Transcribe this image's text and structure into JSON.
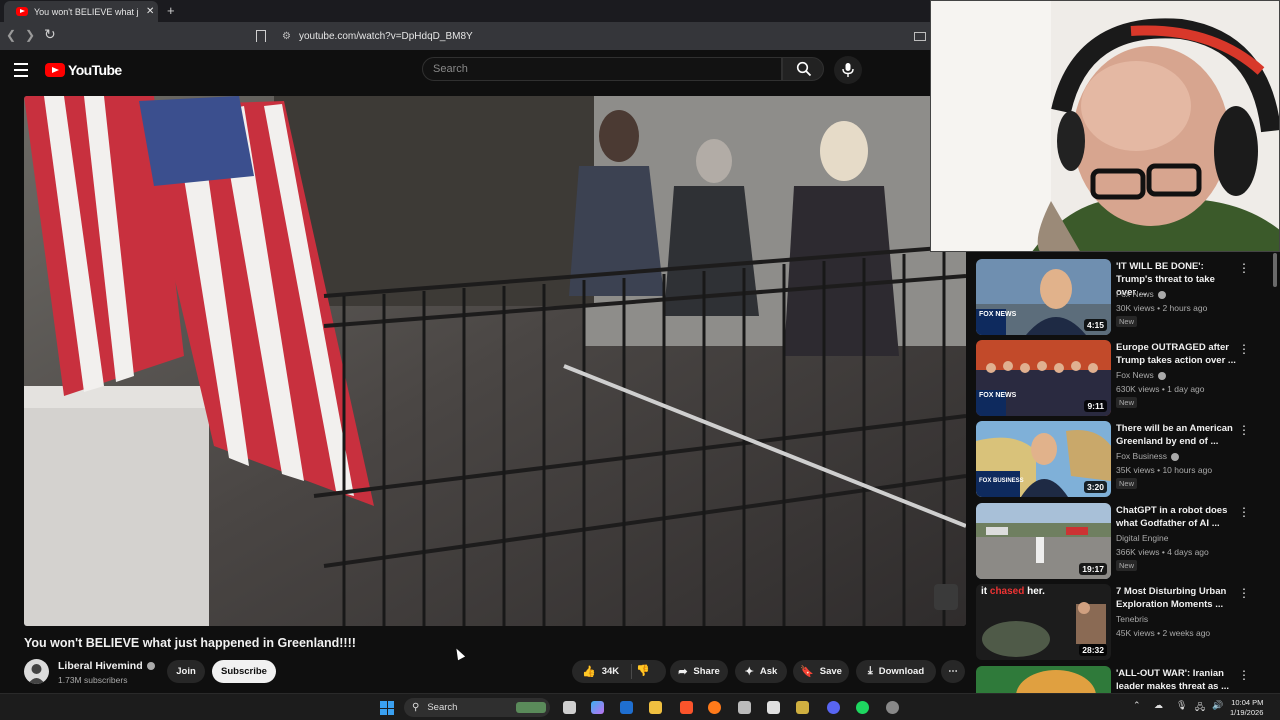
{
  "browser": {
    "tab_title": "You won't BELIEVE what just happened in Greenland!!!!",
    "url": "youtube.com/watch?v=DpHdqD_BM8Y",
    "new_tab": "+",
    "tab_close": "✕"
  },
  "youtube": {
    "logo_text": "YouTube",
    "search_placeholder": "Search"
  },
  "video": {
    "title": "You won't BELIEVE what just happened in Greenland!!!!",
    "channel": "Liberal Hivemind",
    "subscribers": "1.73M subscribers",
    "join_label": "Join",
    "subscribe_label": "Subscribe",
    "likes": "34K",
    "share_label": "Share",
    "ask_label": "Ask",
    "save_label": "Save",
    "download_label": "Download"
  },
  "recommendations": [
    {
      "title": "'IT WILL BE DONE': Trump's threat to take over ...",
      "channel": "Fox News",
      "meta": "30K views • 2 hours ago",
      "badge": "New",
      "duration": "4:15",
      "thumb_label": "FOX NEWS"
    },
    {
      "title": "Europe OUTRAGED after Trump takes action over ...",
      "channel": "Fox News",
      "meta": "630K views • 1 day ago",
      "badge": "New",
      "duration": "9:11",
      "thumb_label": "FOX NEWS"
    },
    {
      "title": "There will be an American Greenland by end of ...",
      "channel": "Fox Business",
      "meta": "35K views • 10 hours ago",
      "badge": "New",
      "duration": "3:20",
      "thumb_label": "FOX BUSINESS"
    },
    {
      "title": "ChatGPT in a robot does what Godfather of AI ...",
      "channel": "Digital Engine",
      "meta": "366K views • 4 days ago",
      "badge": "New",
      "duration": "19:17",
      "thumb_label": ""
    },
    {
      "title": "7 Most Disturbing Urban Exploration Moments ...",
      "channel": "Tenebris",
      "meta": "45K views • 2 weeks ago",
      "badge": "",
      "duration": "28:32",
      "thumb_label": ""
    },
    {
      "title": "'ALL-OUT WAR': Iranian leader makes threat as ...",
      "channel": "",
      "meta": "",
      "badge": "",
      "duration": "",
      "thumb_label": ""
    }
  ],
  "thumb_overlay": {
    "it": "it",
    "chased": "chased",
    "her": "her."
  },
  "taskbar": {
    "search_label": "Search",
    "time": "10:04 PM",
    "date": "1/19/2026"
  },
  "colors": {
    "brand_red": "#ff0000",
    "background": "#0f0f0f",
    "pill_bg": "#272727"
  }
}
